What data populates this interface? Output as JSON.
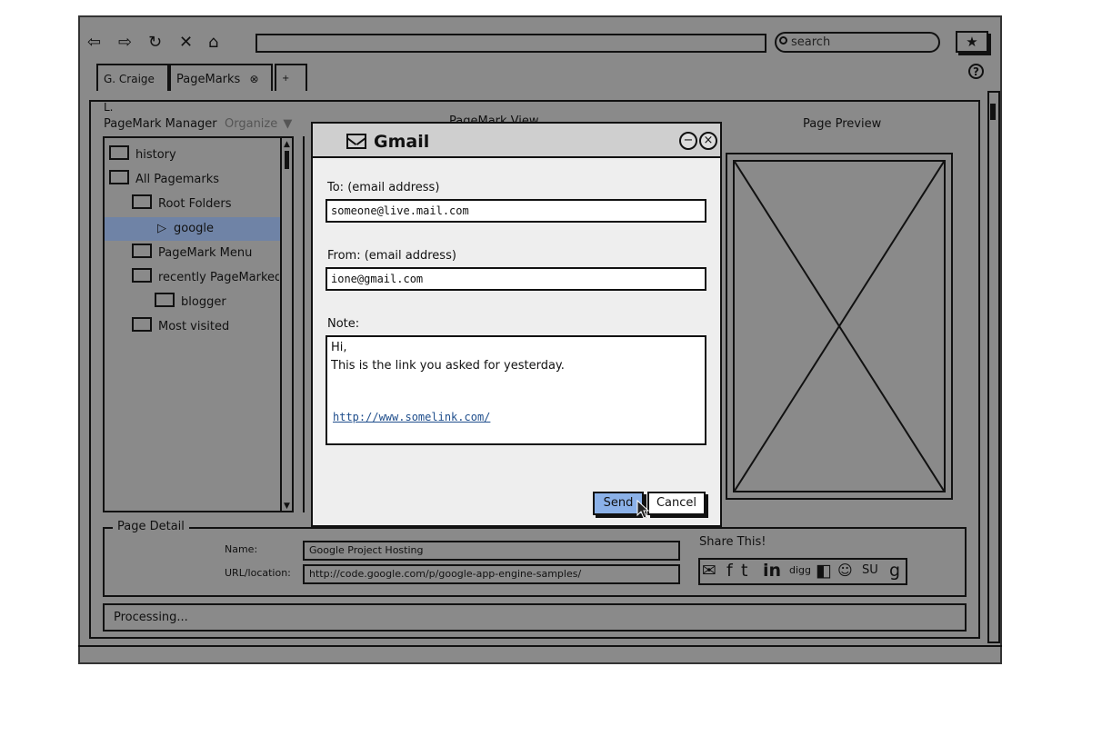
{
  "browser": {
    "search_placeholder": "search",
    "tabs": [
      {
        "label": "G. Craige L."
      },
      {
        "label": "PageMarks"
      },
      {
        "label": "+"
      }
    ]
  },
  "manager": {
    "title": "PageMark Manager",
    "organize_label": "Organize",
    "tree": [
      {
        "label": "history",
        "selected": false
      },
      {
        "label": "All Pagemarks",
        "selected": false
      },
      {
        "label": "Root Folders",
        "selected": false
      },
      {
        "label": "google",
        "selected": true
      },
      {
        "label": "PageMark Menu",
        "selected": false
      },
      {
        "label": "recently PageMarked",
        "selected": false
      },
      {
        "label": "blogger",
        "selected": false
      },
      {
        "label": "Most visited",
        "selected": false
      }
    ]
  },
  "center_title": "PageMark View",
  "preview": {
    "title": "Page Preview"
  },
  "page_detail": {
    "legend": "Page Detail",
    "name_label": "Name:",
    "name_value": "Google Project Hosting",
    "url_label": "URL/location:",
    "url_value": "http://code.google.com/p/google-app-engine-samples/",
    "share_label": "Share This!",
    "share_icons": [
      "email-icon",
      "facebook-icon",
      "twitter-icon",
      "linkedin-icon",
      "digg-icon",
      "delicious-icon",
      "reddit-icon",
      "stumbleupon-icon",
      "google-icon"
    ]
  },
  "status": {
    "text": "Processing..."
  },
  "dialog": {
    "title": "Gmail",
    "to_label": "To: (email address)",
    "to_value": "someone@live.mail.com",
    "from_label": "From: (email address)",
    "from_value": "ione@gmail.com",
    "note_label": "Note:",
    "note_line1": "Hi,",
    "note_line2": "This is the link you asked for yesterday.",
    "note_link": "http://www.somelink.com/",
    "send_label": "Send",
    "cancel_label": "Cancel"
  }
}
